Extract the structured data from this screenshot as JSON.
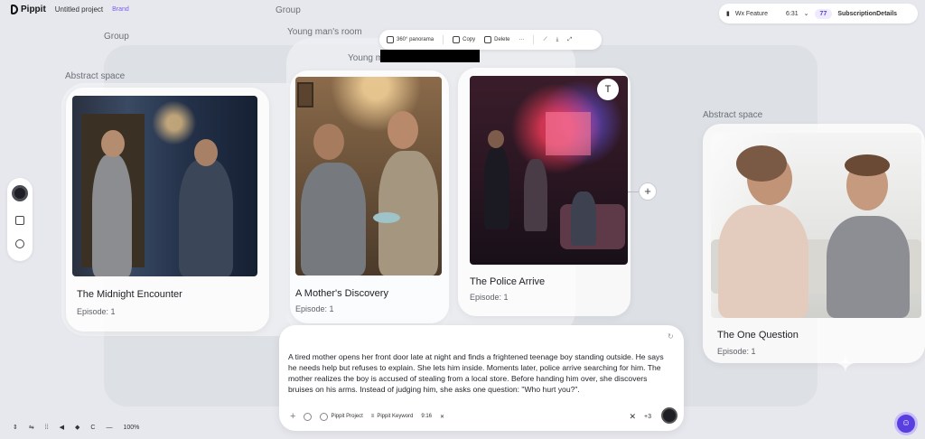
{
  "header": {
    "logo": "Pippit",
    "project_name": "Untitled project",
    "badge": "Brand",
    "right_status": "Wx Feature",
    "right_time": "6:31",
    "credits": "77",
    "account": "SubscriptionDetails"
  },
  "groups": {
    "group_top": "Group",
    "group_left": "Group",
    "room_label": "Young man's room",
    "room_label_sub": "Young m",
    "abstract_left": "Abstract space",
    "abstract_right": "Abstract space"
  },
  "toolbar": {
    "panorama": "360° panorama",
    "copy": "Copy",
    "delete": "Delete",
    "more": "···"
  },
  "cards": [
    {
      "title": "The Midnight Encounter",
      "episode": "Episode: 1"
    },
    {
      "title": "A Mother's Discovery",
      "episode": "Episode: 1"
    },
    {
      "title": "The Police Arrive",
      "episode": "Episode: 1"
    },
    {
      "title": "The One Question",
      "episode": "Episode: 1"
    }
  ],
  "icons": {
    "text_tool": "T",
    "add_node": "+"
  },
  "prompt": {
    "text": "A tired mother opens her front door late at night and finds a frightened teenage boy standing outside. He says he needs help but refuses to explain. She lets him inside. Moments later, police arrive searching for him. The mother realizes the boy is accused of stealing from a local store. Before handing him over, she discovers bruises on his arms. Instead of judging him, she asks one question: \"Who hurt you?\".",
    "plus": "+",
    "project_chip": "Pippit Project",
    "keyword_chip": "Pippit Keyword",
    "ratio": "9:16",
    "close": "✕",
    "count": "+3"
  },
  "bottom": {
    "zoom": "100%"
  },
  "colors": {
    "accent": "#5a3fe0",
    "background": "#e7e8ed"
  }
}
